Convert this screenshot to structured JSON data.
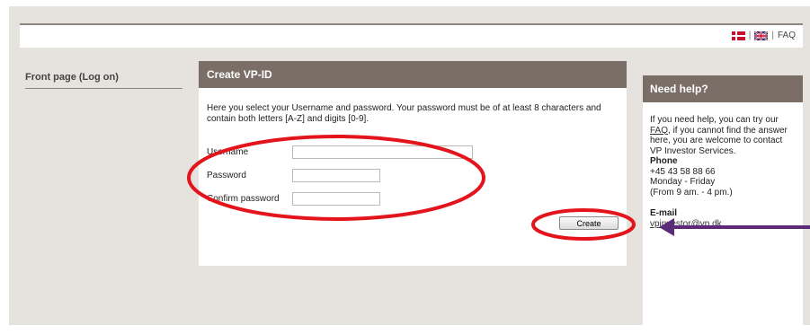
{
  "header": {
    "lang_danish_icon": "danish-flag-icon",
    "lang_english_icon": "uk-flag-icon",
    "separator": "|",
    "faq_label": "FAQ"
  },
  "sidebar": {
    "front_page_label": "Front page (Log on)"
  },
  "main": {
    "title": "Create VP-ID",
    "intro": "Here you select your Username and password. Your password must be of at least 8 characters and contain both letters [A-Z] and digits [0-9].",
    "username_label": "Username",
    "password_label": "Password",
    "confirm_password_label": "Confirm password",
    "username_value": "",
    "password_value": "",
    "confirm_password_value": "",
    "create_button": "Create"
  },
  "help": {
    "title": "Need help?",
    "text_before": "If you need help, you can try our ",
    "faq_link": "FAQ",
    "text_after": ", if you cannot find the answer here, you are welcome to contact VP Investor Services.",
    "phone_heading": "Phone",
    "phone_number": "+45 43 58 88 66",
    "hours_days": "Monday - Friday",
    "hours_time": "(From 9 am. - 4 pm.)",
    "email_heading": "E-mail",
    "email": "vpinvestor@vp.dk",
    "email_suffix": "."
  },
  "colors": {
    "panel_header": "#7a6e66",
    "background": "#e6e3de",
    "annotation_red": "#e3141b",
    "annotation_arrow": "#5b2a78"
  }
}
